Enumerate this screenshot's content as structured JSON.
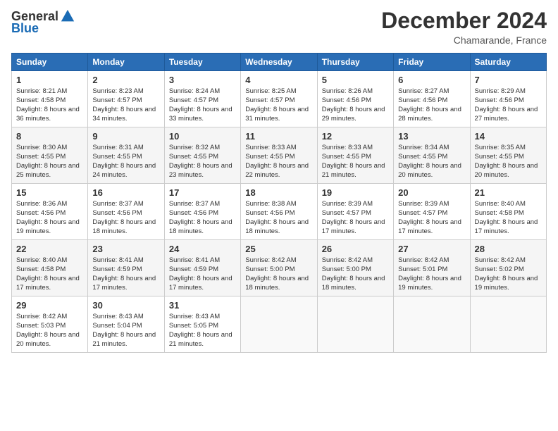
{
  "header": {
    "logo": {
      "general": "General",
      "blue": "Blue",
      "tagline": ""
    },
    "title": "December 2024",
    "location": "Chamarande, France"
  },
  "days_of_week": [
    "Sunday",
    "Monday",
    "Tuesday",
    "Wednesday",
    "Thursday",
    "Friday",
    "Saturday"
  ],
  "weeks": [
    [
      {
        "day": "1",
        "sunrise": "Sunrise: 8:21 AM",
        "sunset": "Sunset: 4:58 PM",
        "daylight": "Daylight: 8 hours and 36 minutes."
      },
      {
        "day": "2",
        "sunrise": "Sunrise: 8:23 AM",
        "sunset": "Sunset: 4:57 PM",
        "daylight": "Daylight: 8 hours and 34 minutes."
      },
      {
        "day": "3",
        "sunrise": "Sunrise: 8:24 AM",
        "sunset": "Sunset: 4:57 PM",
        "daylight": "Daylight: 8 hours and 33 minutes."
      },
      {
        "day": "4",
        "sunrise": "Sunrise: 8:25 AM",
        "sunset": "Sunset: 4:57 PM",
        "daylight": "Daylight: 8 hours and 31 minutes."
      },
      {
        "day": "5",
        "sunrise": "Sunrise: 8:26 AM",
        "sunset": "Sunset: 4:56 PM",
        "daylight": "Daylight: 8 hours and 29 minutes."
      },
      {
        "day": "6",
        "sunrise": "Sunrise: 8:27 AM",
        "sunset": "Sunset: 4:56 PM",
        "daylight": "Daylight: 8 hours and 28 minutes."
      },
      {
        "day": "7",
        "sunrise": "Sunrise: 8:29 AM",
        "sunset": "Sunset: 4:56 PM",
        "daylight": "Daylight: 8 hours and 27 minutes."
      }
    ],
    [
      {
        "day": "8",
        "sunrise": "Sunrise: 8:30 AM",
        "sunset": "Sunset: 4:55 PM",
        "daylight": "Daylight: 8 hours and 25 minutes."
      },
      {
        "day": "9",
        "sunrise": "Sunrise: 8:31 AM",
        "sunset": "Sunset: 4:55 PM",
        "daylight": "Daylight: 8 hours and 24 minutes."
      },
      {
        "day": "10",
        "sunrise": "Sunrise: 8:32 AM",
        "sunset": "Sunset: 4:55 PM",
        "daylight": "Daylight: 8 hours and 23 minutes."
      },
      {
        "day": "11",
        "sunrise": "Sunrise: 8:33 AM",
        "sunset": "Sunset: 4:55 PM",
        "daylight": "Daylight: 8 hours and 22 minutes."
      },
      {
        "day": "12",
        "sunrise": "Sunrise: 8:33 AM",
        "sunset": "Sunset: 4:55 PM",
        "daylight": "Daylight: 8 hours and 21 minutes."
      },
      {
        "day": "13",
        "sunrise": "Sunrise: 8:34 AM",
        "sunset": "Sunset: 4:55 PM",
        "daylight": "Daylight: 8 hours and 20 minutes."
      },
      {
        "day": "14",
        "sunrise": "Sunrise: 8:35 AM",
        "sunset": "Sunset: 4:55 PM",
        "daylight": "Daylight: 8 hours and 20 minutes."
      }
    ],
    [
      {
        "day": "15",
        "sunrise": "Sunrise: 8:36 AM",
        "sunset": "Sunset: 4:56 PM",
        "daylight": "Daylight: 8 hours and 19 minutes."
      },
      {
        "day": "16",
        "sunrise": "Sunrise: 8:37 AM",
        "sunset": "Sunset: 4:56 PM",
        "daylight": "Daylight: 8 hours and 18 minutes."
      },
      {
        "day": "17",
        "sunrise": "Sunrise: 8:37 AM",
        "sunset": "Sunset: 4:56 PM",
        "daylight": "Daylight: 8 hours and 18 minutes."
      },
      {
        "day": "18",
        "sunrise": "Sunrise: 8:38 AM",
        "sunset": "Sunset: 4:56 PM",
        "daylight": "Daylight: 8 hours and 18 minutes."
      },
      {
        "day": "19",
        "sunrise": "Sunrise: 8:39 AM",
        "sunset": "Sunset: 4:57 PM",
        "daylight": "Daylight: 8 hours and 17 minutes."
      },
      {
        "day": "20",
        "sunrise": "Sunrise: 8:39 AM",
        "sunset": "Sunset: 4:57 PM",
        "daylight": "Daylight: 8 hours and 17 minutes."
      },
      {
        "day": "21",
        "sunrise": "Sunrise: 8:40 AM",
        "sunset": "Sunset: 4:58 PM",
        "daylight": "Daylight: 8 hours and 17 minutes."
      }
    ],
    [
      {
        "day": "22",
        "sunrise": "Sunrise: 8:40 AM",
        "sunset": "Sunset: 4:58 PM",
        "daylight": "Daylight: 8 hours and 17 minutes."
      },
      {
        "day": "23",
        "sunrise": "Sunrise: 8:41 AM",
        "sunset": "Sunset: 4:59 PM",
        "daylight": "Daylight: 8 hours and 17 minutes."
      },
      {
        "day": "24",
        "sunrise": "Sunrise: 8:41 AM",
        "sunset": "Sunset: 4:59 PM",
        "daylight": "Daylight: 8 hours and 17 minutes."
      },
      {
        "day": "25",
        "sunrise": "Sunrise: 8:42 AM",
        "sunset": "Sunset: 5:00 PM",
        "daylight": "Daylight: 8 hours and 18 minutes."
      },
      {
        "day": "26",
        "sunrise": "Sunrise: 8:42 AM",
        "sunset": "Sunset: 5:00 PM",
        "daylight": "Daylight: 8 hours and 18 minutes."
      },
      {
        "day": "27",
        "sunrise": "Sunrise: 8:42 AM",
        "sunset": "Sunset: 5:01 PM",
        "daylight": "Daylight: 8 hours and 19 minutes."
      },
      {
        "day": "28",
        "sunrise": "Sunrise: 8:42 AM",
        "sunset": "Sunset: 5:02 PM",
        "daylight": "Daylight: 8 hours and 19 minutes."
      }
    ],
    [
      {
        "day": "29",
        "sunrise": "Sunrise: 8:42 AM",
        "sunset": "Sunset: 5:03 PM",
        "daylight": "Daylight: 8 hours and 20 minutes."
      },
      {
        "day": "30",
        "sunrise": "Sunrise: 8:43 AM",
        "sunset": "Sunset: 5:04 PM",
        "daylight": "Daylight: 8 hours and 21 minutes."
      },
      {
        "day": "31",
        "sunrise": "Sunrise: 8:43 AM",
        "sunset": "Sunset: 5:05 PM",
        "daylight": "Daylight: 8 hours and 21 minutes."
      },
      null,
      null,
      null,
      null
    ]
  ]
}
